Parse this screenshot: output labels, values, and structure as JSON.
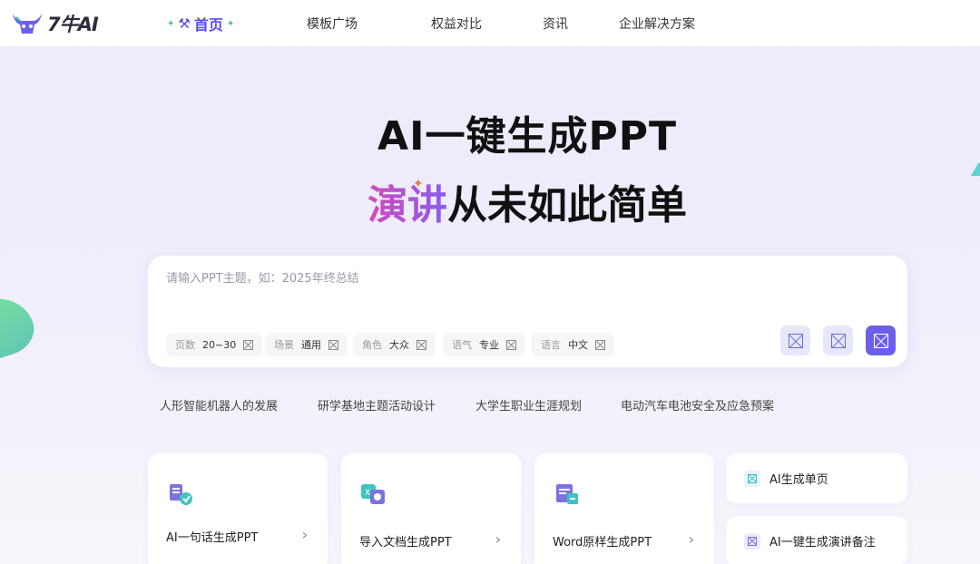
{
  "header": {
    "logo_text": "7牛AI",
    "nav": {
      "home": "首页",
      "templates": "模板广场",
      "compare": "权益对比",
      "news": "资讯",
      "enterprise": "企业解决方案"
    }
  },
  "hero": {
    "title": "AI一键生成PPT",
    "subtitle_highlight": "演讲",
    "subtitle_rest": "从未如此简单"
  },
  "input": {
    "placeholder": "请输入PPT主题，如：2025年终总结",
    "options": [
      {
        "label": "页数",
        "value": "20~30"
      },
      {
        "label": "场景",
        "value": "通用"
      },
      {
        "label": "角色",
        "value": "大众"
      },
      {
        "label": "语气",
        "value": "专业"
      },
      {
        "label": "语言",
        "value": "中文"
      }
    ]
  },
  "suggestions": [
    "人形智能机器人的发展",
    "研学基地主题活动设计",
    "大学生职业生涯规划",
    "电动汽车电池安全及应急预案"
  ],
  "features": [
    {
      "label": "AI一句话生成PPT",
      "icon": "chat-doc-icon"
    },
    {
      "label": "导入文档生成PPT",
      "icon": "import-doc-icon"
    },
    {
      "label": "Word原样生成PPT",
      "icon": "word-doc-icon"
    }
  ],
  "mini_features": [
    {
      "label": "AI生成单页"
    },
    {
      "label": "AI一键生成演讲备注"
    }
  ],
  "colors": {
    "accent": "#6b5fe8",
    "brand_purple": "#5b4be0",
    "teal": "#38c6a6"
  }
}
